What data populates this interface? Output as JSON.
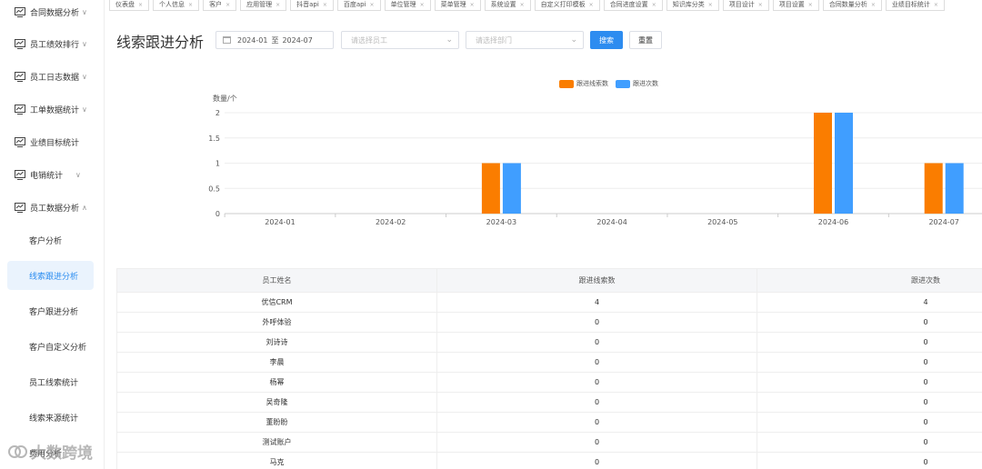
{
  "sidebar": {
    "items": [
      {
        "label": "合同数据分析",
        "chevron": "∨"
      },
      {
        "label": "员工绩效排行",
        "chevron": "∨"
      },
      {
        "label": "员工日志数据",
        "chevron": "∨"
      },
      {
        "label": "工单数据统计",
        "chevron": "∨"
      },
      {
        "label": "业绩目标统计",
        "chevron": ""
      },
      {
        "label": "电销统计",
        "chevron": "∨"
      },
      {
        "label": "员工数据分析",
        "chevron": "∧"
      }
    ],
    "sub_items": [
      "客户分析",
      "线索跟进分析",
      "客户跟进分析",
      "客户自定义分析",
      "员工线索统计",
      "线索来源统计",
      "费用分析"
    ],
    "active_sub": "线索跟进分析"
  },
  "tabs": [
    "仪表盘",
    "个人信息",
    "客户",
    "应用管理",
    "抖音api",
    "百度api",
    "单位管理",
    "菜单管理",
    "系统设置",
    "自定义打印模板",
    "合同进度设置",
    "知识库分类",
    "项目设计",
    "项目设置",
    "合同数量分析",
    "业绩目标统计"
  ],
  "toolbar": {
    "title": "线索跟进分析",
    "date_start": "2024-01",
    "date_sep": "至",
    "date_end": "2024-07",
    "employee_placeholder": "请选择员工",
    "dept_placeholder": "请选择部门",
    "search_label": "搜索",
    "reset_label": "重置"
  },
  "chart_data": {
    "type": "bar",
    "categories": [
      "2024-01",
      "2024-02",
      "2024-03",
      "2024-04",
      "2024-05",
      "2024-06",
      "2024-07"
    ],
    "series": [
      {
        "name": "跟进线索数",
        "values": [
          0,
          0,
          1,
          0,
          0,
          2,
          1
        ],
        "color": "#fa7d00"
      },
      {
        "name": "跟进次数",
        "values": [
          0,
          0,
          1,
          0,
          0,
          2,
          1
        ],
        "color": "#409eff"
      }
    ],
    "ylabel": "数量/个",
    "yticks": [
      "0",
      "0.5",
      "1",
      "1.5",
      "2"
    ],
    "ylim": [
      0,
      2
    ],
    "legend_position": "top-center",
    "grid": true
  },
  "table": {
    "headers": [
      "员工姓名",
      "跟进线索数",
      "跟进次数"
    ],
    "rows": [
      [
        "优信CRM",
        "4",
        "4"
      ],
      [
        "外呼体验",
        "0",
        "0"
      ],
      [
        "刘诗诗",
        "0",
        "0"
      ],
      [
        "李晨",
        "0",
        "0"
      ],
      [
        "杨幂",
        "0",
        "0"
      ],
      [
        "吴奇隆",
        "0",
        "0"
      ],
      [
        "董盼盼",
        "0",
        "0"
      ],
      [
        "测试账户",
        "0",
        "0"
      ],
      [
        "马克",
        "0",
        "0"
      ]
    ]
  },
  "watermark": {
    "text": "大数跨境"
  }
}
